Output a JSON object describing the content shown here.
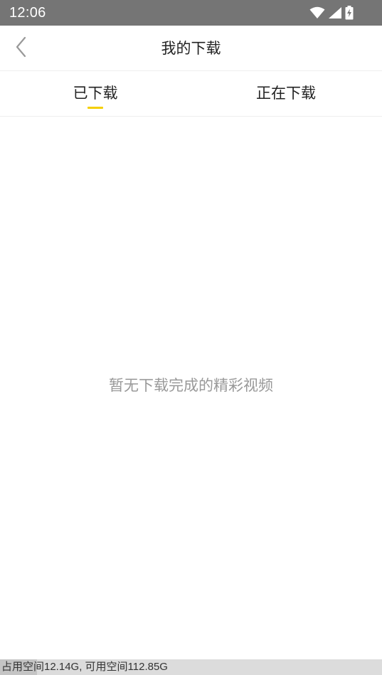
{
  "status_bar": {
    "time": "12:06",
    "icons": [
      "wifi-icon",
      "signal-icon",
      "battery-charging-icon"
    ]
  },
  "header": {
    "back_icon": "chevron-left-icon",
    "title": "我的下载"
  },
  "tabs": [
    {
      "label": "已下载",
      "selected": true
    },
    {
      "label": "正在下载",
      "selected": false
    }
  ],
  "empty_state": {
    "message": "暂无下载完成的精彩视频"
  },
  "storage": {
    "text": "占用空间12.14G, 可用空间112.85G",
    "used_fraction": 0.097
  },
  "colors": {
    "status_bar_bg": "#757575",
    "accent": "#f5cf00",
    "empty_text": "#999999"
  }
}
